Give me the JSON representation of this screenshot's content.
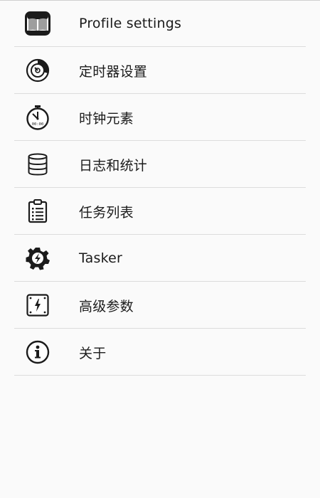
{
  "menu": {
    "items": [
      {
        "label": "Profile settings",
        "icon": "book-icon"
      },
      {
        "label": "定时器设置",
        "icon": "timer-dial-icon"
      },
      {
        "label": "时钟元素",
        "icon": "clock-icon"
      },
      {
        "label": "日志和统计",
        "icon": "database-icon"
      },
      {
        "label": "任务列表",
        "icon": "clipboard-list-icon"
      },
      {
        "label": "Tasker",
        "icon": "tasker-gear-icon"
      },
      {
        "label": "高级参数",
        "icon": "power-panel-icon"
      },
      {
        "label": "关于",
        "icon": "info-icon"
      }
    ]
  },
  "clock_icon_text": "00:00"
}
